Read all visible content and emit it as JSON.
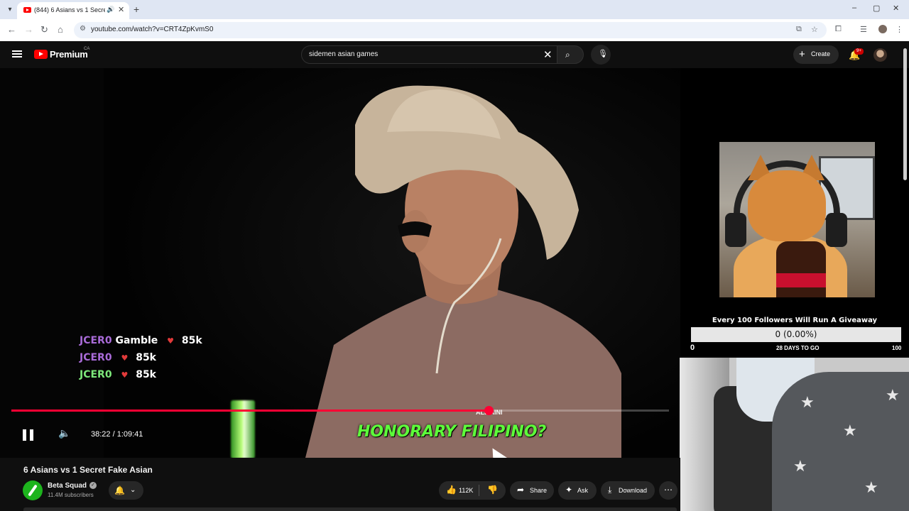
{
  "browser": {
    "tab_title": "(844) 6 Asians vs 1 Secret Fa",
    "url": "youtube.com/watch?v=CRT4ZpKvmS0",
    "window_controls": [
      "–",
      "▢",
      "✕"
    ]
  },
  "youtube": {
    "brand": "Premium",
    "country": "CA",
    "search_query": "sidemen asian games",
    "create_label": "Create",
    "notification_badge": "9+"
  },
  "player": {
    "chat": [
      {
        "user": "JCER0",
        "word": "Gamble",
        "amount": "85k",
        "user_color": "#a96bd8"
      },
      {
        "user": "JCER0",
        "word": "",
        "amount": "85k",
        "user_color": "#a96bd8"
      },
      {
        "user": "JCER0",
        "word": "",
        "amount": "85k",
        "user_color": "#7de87a"
      }
    ],
    "caption": "HONORARY FILIPINO?",
    "time_current": "38:22",
    "time_total": "1:09:41",
    "progress_fraction": 0.7252,
    "accent_color": "#ff0033"
  },
  "stream_overlay": {
    "giveaway_title": "Every 100 Followers Will Run A Giveaway",
    "giveaway_value": "0 (0.00%)",
    "giveaway_min": "0",
    "giveaway_days": "28 DAYS TO GO",
    "giveaway_max": "100"
  },
  "video": {
    "title": "6 Asians vs 1 Secret Fake Asian",
    "channel": "Beta Squad",
    "subscribers": "11.4M subscribers",
    "likes": "112K",
    "share_label": "Share",
    "ask_label": "Ask",
    "download_label": "Download"
  }
}
